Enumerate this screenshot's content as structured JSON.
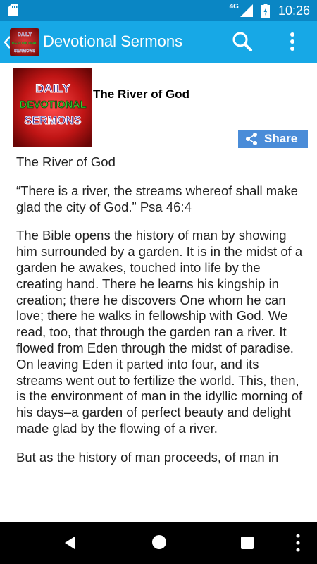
{
  "status_bar": {
    "time": "10:26",
    "network": "4G",
    "icons": [
      "sd-card-icon",
      "signal-icon",
      "battery-icon"
    ]
  },
  "app_bar": {
    "title": "Devotional Sermons",
    "logo_text": [
      "DAILY",
      "DEVOTIONAL",
      "SERMONS"
    ],
    "icons": [
      "back-chevron-icon",
      "search-icon",
      "overflow-menu-icon"
    ]
  },
  "post": {
    "thumbnail_text": [
      "DAILY",
      "DEVOTIONAL",
      "SERMONS"
    ],
    "title": "The River of God",
    "share_label": "Share",
    "paragraphs": [
      "The River of God",
      "“There is a river, the streams whereof shall make glad the city of God.” Psa 46:4",
      "The Bible opens the history of man by showing him surrounded by a garden. It is in the midst of a garden he awakes, touched into life by the creating hand. There he learns his kingship in creation; there he discovers One whom he can love; there he walks in fellowship with God. We read, too, that through the garden ran a river. It flowed from Eden through the midst of paradise. On leaving Eden it parted into four, and its streams went out to fertilize the world. This, then, is the environment of man in the idyllic morning of his days–a garden of perfect beauty and delight made glad by the flowing of a river.",
      "But as the history of man proceeds, of man in"
    ]
  },
  "nav_bar": {
    "icons": [
      "back-icon",
      "home-icon",
      "recents-icon",
      "more-icon"
    ]
  },
  "colors": {
    "status_bar": "#0a86c4",
    "app_bar": "#17a8e6",
    "share_button": "#4a8cd8",
    "thumb_red": "#b71818",
    "thumb_green": "#37d12f",
    "thumb_purple": "#3e2a8c"
  }
}
